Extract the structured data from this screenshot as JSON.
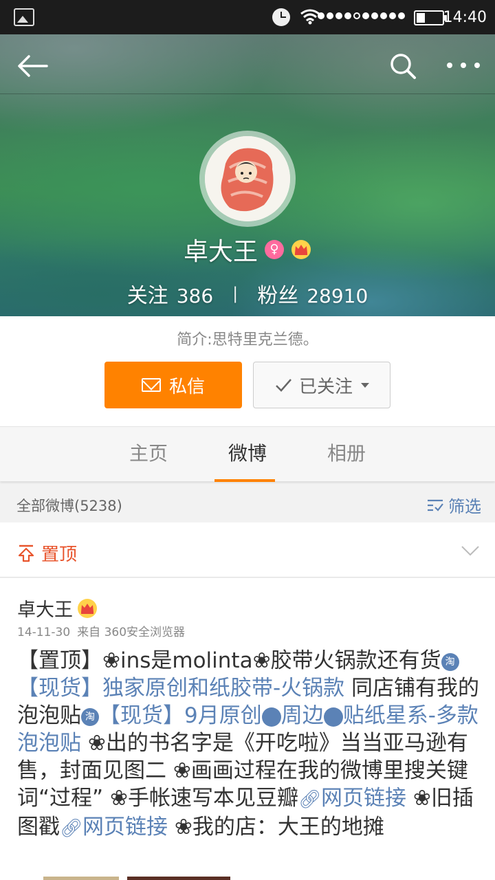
{
  "status_bar": {
    "time": "14:40"
  },
  "profile": {
    "name": "卓大王",
    "female_badge": "♀",
    "follow_label": "关注",
    "follow_count": "386",
    "separator": "|",
    "fans_label": "粉丝",
    "fans_count": "28910",
    "intro": "简介:思特里克兰德。",
    "message_button": "私信",
    "followed_button": "已关注"
  },
  "tabs": [
    {
      "label": "主页"
    },
    {
      "label": "微博"
    },
    {
      "label": "相册"
    }
  ],
  "filter_bar": {
    "all_posts": "全部微博(5238)",
    "filter_label": "筛选"
  },
  "pinned": {
    "label": "置顶"
  },
  "post": {
    "author": "卓大王",
    "date": "14-11-30",
    "source": "来自 360安全浏览器",
    "text_1": "【置顶】",
    "flower": "❀",
    "text_2": "ins是molinta",
    "text_3": "胶带火锅款还有货",
    "taobao_icon": "淘",
    "link_1": "【现货】独家原创和纸胶带-火锅款",
    "text_4": " 同店铺有我的泡泡贴",
    "link_2": "【现货】9月原创",
    "link_3": "周边",
    "link_4": "贴纸星系-多款泡泡贴",
    "text_5": "出的书名字是《开吃啦》当当亚马逊有售，封面见图二 ",
    "text_6": "画画过程在我的微博里搜关键词“过程” ",
    "text_7": "手帐速写本见豆瓣",
    "link_web_1": "网页链接",
    "text_8": "旧插图戳",
    "link_web_2": "网页链接",
    "text_9": "我的店：大王的地摊"
  },
  "colors": {
    "accent_orange": "#ff8200",
    "link_blue": "#5b82b6",
    "pin_red": "#e8542c"
  }
}
